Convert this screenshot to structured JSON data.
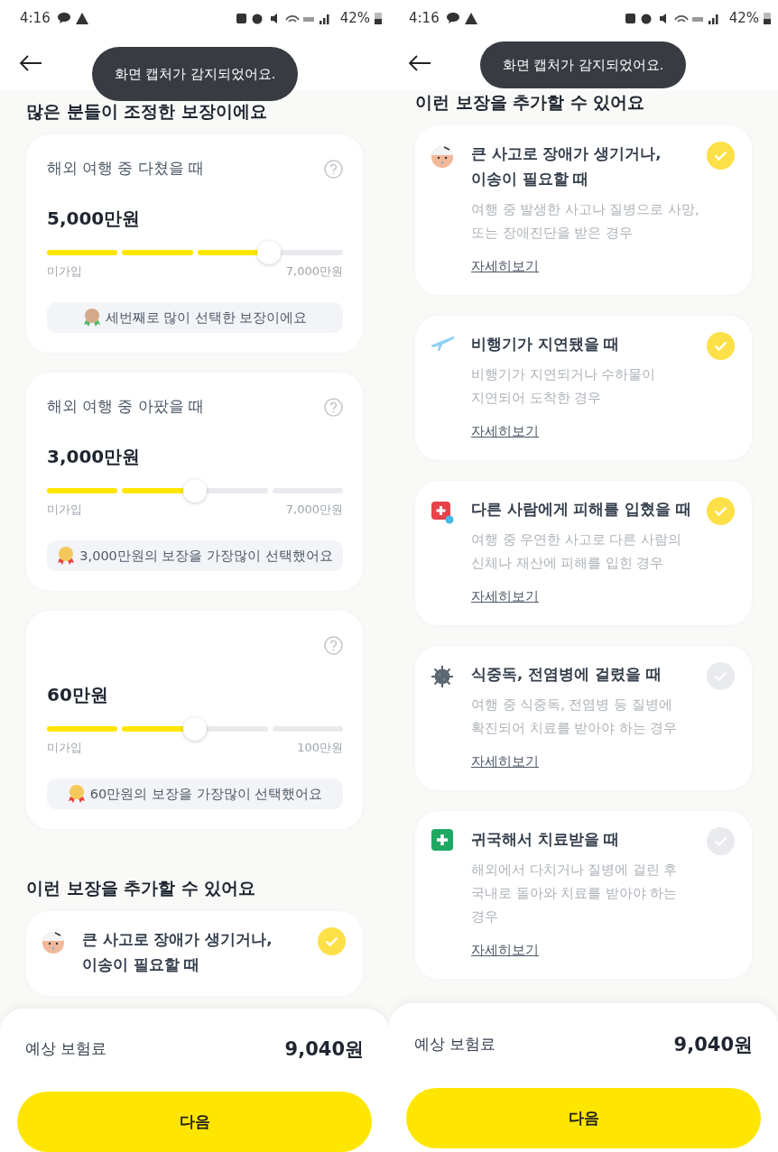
{
  "screens": [
    {
      "status_bar": {
        "time": "4:16",
        "battery": "42%"
      },
      "toast": "화면 캡처가 감지되었어요.",
      "sections": [
        {
          "kind": "sliders",
          "heading": "많은 분들이 조정한 보장이에요",
          "cards": [
            {
              "title": "해외 여행 중 다쳤을 때",
              "amount": "5,000만원",
              "level": 0.75,
              "min_label": "미가입",
              "max_label": "7,000만원",
              "badge": "세번째로 많이 선택한 보장이에요",
              "kind": "bronze"
            },
            {
              "title": "해외 여행 중 아팠을 때",
              "amount": "3,000만원",
              "level": 0.5,
              "min_label": "미가입",
              "max_label": "7,000만원",
              "badge": "3,000만원의 보장을 가장많이 선택했어요",
              "kind": "gold"
            },
            {
              "amount": "60만원",
              "level": 0.5,
              "min_label": "미가입",
              "max_label": "100만원",
              "badge": "60만원의 보장을 가장많이 선택했어요",
              "kind": "gold"
            }
          ]
        },
        {
          "kind": "options",
          "heading": "이런 보장을 추가할 수 있어요",
          "cards": [
            {
              "kind": "injured-face",
              "title": "큰 사고로 장애가 생기거나,\n이송이 필요할 때",
              "checked": true
            }
          ]
        }
      ],
      "footer": {
        "label": "예상 보험료",
        "price": "9,040원",
        "button": "다음"
      }
    },
    {
      "status_bar": {
        "time": "4:16",
        "battery": "42%"
      },
      "toast": "화면 캡처가 감지되었어요.",
      "sections": [
        {
          "kind": "options",
          "heading": "이런 보장을 추가할 수 있어요",
          "cards": [
            {
              "kind": "injured-face",
              "title": "큰 사고로 장애가 생기거나,\n이송이 필요할 때",
              "description": "여행 중 발생한 사고나 질병으로 사망,\n또는 장애진단을 받은 경우",
              "link": "자세히보기",
              "checked": true
            },
            {
              "kind": "airplane",
              "title": "비행기가 지연됐을 때",
              "description": "비행기가 지연되거나 수하물이\n지연되어 도착한 경우",
              "link": "자세히보기",
              "checked": true
            },
            {
              "kind": "medical-bag",
              "title": "다른 사람에게 피해를 입혔을 때",
              "description": "여행 중 우연한 사고로 다른 사람의\n신체나 재산에 피해를 입힌 경우",
              "link": "자세히보기",
              "checked": true
            },
            {
              "kind": "virus",
              "title": "식중독, 전염병에 걸렸을 때",
              "description": "여행 중 식중독, 전염병 등 질병에\n확진되어 치료를 받아야 하는 경우",
              "link": "자세히보기",
              "checked": false
            },
            {
              "kind": "first-aid",
              "title": "귀국해서 치료받을 때",
              "description": "해외에서 다치거나 질병에 걸린 후\n국내로 돌아와 치료를 받아야 하는\n경우",
              "link": "자세히보기",
              "checked": false
            }
          ]
        }
      ],
      "footer": {
        "label": "예상 보험료",
        "price": "9,040원",
        "button": "다음"
      }
    }
  ]
}
